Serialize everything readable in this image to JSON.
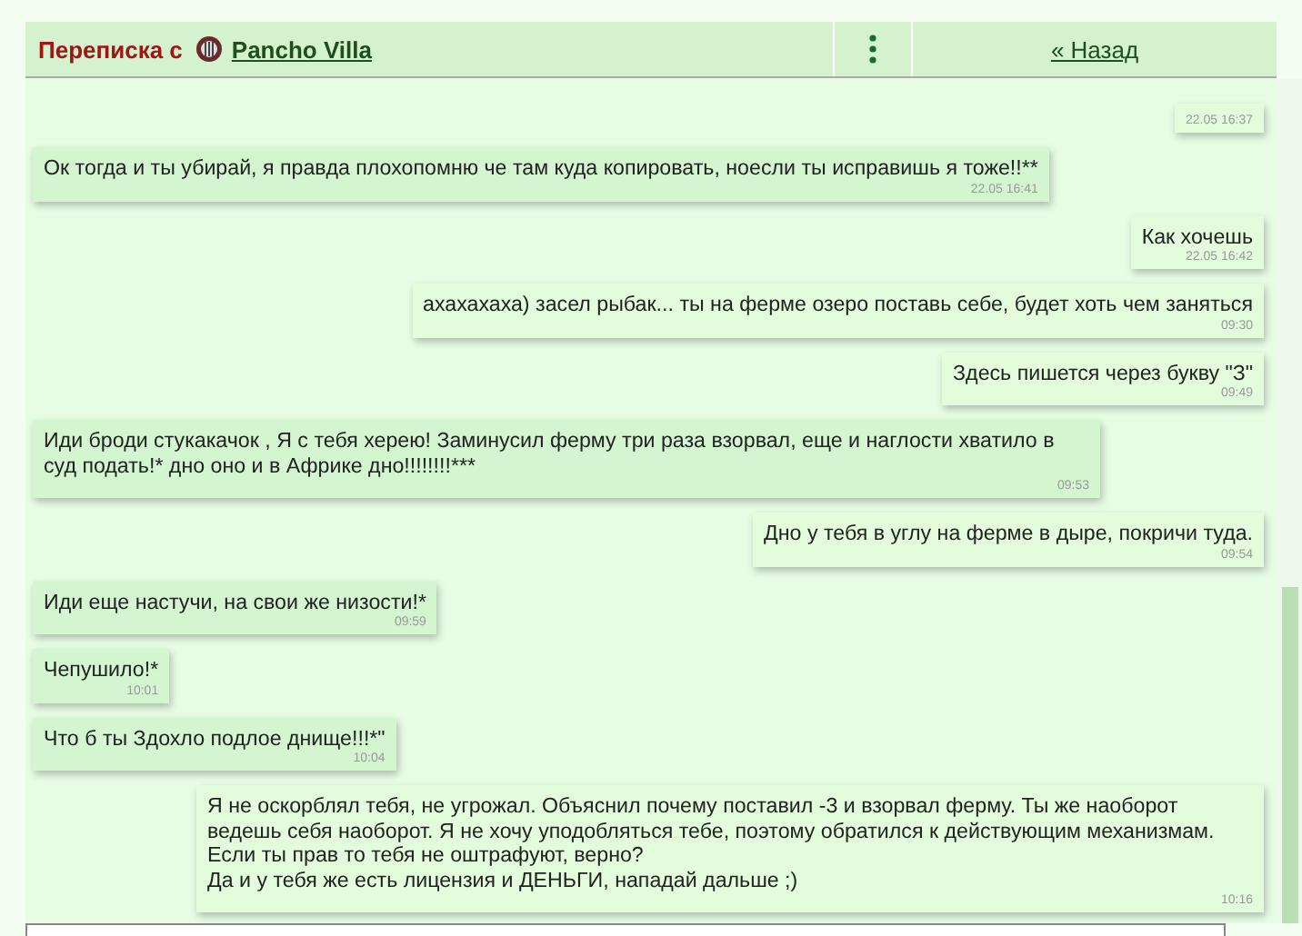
{
  "header": {
    "title": "Переписка с",
    "contact": "Pancho Villa",
    "back_link": "« Назад"
  },
  "messages": [
    {
      "kind": "outgoing",
      "time": "22.05 16:37"
    },
    {
      "kind": "incoming",
      "text": "Ок тогда и ты убирай, я правда плохопомню че там куда копировать, ноесли ты исправишь я тоже!!**",
      "time": "22.05 16:41"
    },
    {
      "kind": "outgoing",
      "text": "Как хочешь",
      "time": "22.05 16:42"
    },
    {
      "kind": "outgoing",
      "text": "ахахахаха) засел рыбак... ты на ферме озеро поставь себе, будет хоть чем заняться",
      "time": "09:30"
    },
    {
      "kind": "outgoing",
      "text": "Здесь пишется через букву \"З\"",
      "time": "09:49"
    },
    {
      "kind": "incoming",
      "text": "Иди броди стукакачок , Я с тебя херею! Заминусил ферму три раза взорвал, еще и наглости хватило в суд подать!* дно оно и в Африке дно!!!!!!!!***",
      "time": "09:53"
    },
    {
      "kind": "outgoing",
      "text": "Дно у тебя в углу на ферме в дыре, покричи туда.",
      "time": "09:54"
    },
    {
      "kind": "incoming",
      "text": "Иди еще настучи, на свои же низости!*",
      "time": "09:59"
    },
    {
      "kind": "incoming",
      "text": "Чепушило!*",
      "time": "10:01"
    },
    {
      "kind": "incoming",
      "text": "Что б ты Здохло подлое днище!!!*\"",
      "time": "10:04"
    },
    {
      "kind": "outgoing",
      "text": "Я не оскорблял тебя, не угрожал. Объяснил почему поставил -3 и взорвал ферму. Ты же наоборот ведешь себя наоборот. Я не хочу уподобляться тебе, поэтому обратился к действующим механизмам. Если ты прав то тебя не оштрафуют, верно?\nДа и у тебя же есть лицензия и ДЕНЬГИ, нападай дальше ;)",
      "time": "10:16"
    }
  ]
}
